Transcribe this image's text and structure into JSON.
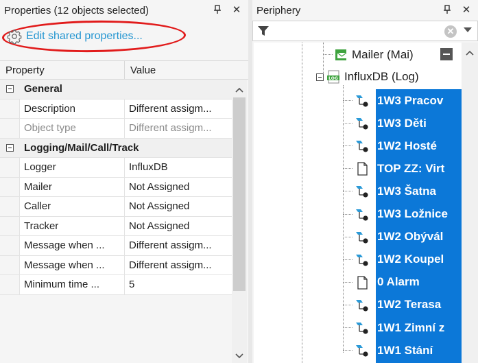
{
  "properties": {
    "title": "Properties (12 objects selected)",
    "pin_icon": "pin-icon",
    "close_glyph": "✕",
    "edit_shared_label": "Edit shared properties...",
    "header": {
      "property": "Property",
      "value": "Value"
    },
    "rows": [
      {
        "type": "category",
        "label": "General"
      },
      {
        "type": "row",
        "name": "Description",
        "value": "Different assigm...",
        "grey": false
      },
      {
        "type": "row",
        "name": "Object type",
        "value": "Different assigm...",
        "grey": true
      },
      {
        "type": "category",
        "label": "Logging/Mail/Call/Track"
      },
      {
        "type": "row",
        "name": "Logger",
        "value": "InfluxDB",
        "grey": false
      },
      {
        "type": "row",
        "name": "Mailer",
        "value": "Not Assigned",
        "grey": false
      },
      {
        "type": "row",
        "name": "Caller",
        "value": "Not Assigned",
        "grey": false
      },
      {
        "type": "row",
        "name": "Tracker",
        "value": "Not Assigned",
        "grey": false
      },
      {
        "type": "row",
        "name": "Message when ...",
        "value": "Different assigm...",
        "grey": false
      },
      {
        "type": "row",
        "name": "Message when ...",
        "value": "Different assigm...",
        "grey": false
      },
      {
        "type": "row",
        "name": "Minimum time ...",
        "value": "5",
        "grey": false
      }
    ]
  },
  "periphery": {
    "title": "Periphery",
    "close_glyph": "✕",
    "filter_value": "",
    "clear_glyph": "✕",
    "mailer_node": "Mailer (Mai)",
    "influx_node": "InfluxDB (Log)",
    "items": [
      {
        "label": "1W3 Pracov",
        "icon": "sensor-icon"
      },
      {
        "label": "1W3 Děti",
        "icon": "sensor-icon"
      },
      {
        "label": "1W2 Hosté",
        "icon": "sensor-icon"
      },
      {
        "label": "TOP ZZ: Virt",
        "icon": "document-icon"
      },
      {
        "label": "1W3 Šatna",
        "icon": "sensor-icon"
      },
      {
        "label": "1W3 Ložnice",
        "icon": "sensor-icon"
      },
      {
        "label": "1W2 Obývál",
        "icon": "sensor-icon"
      },
      {
        "label": "1W2 Koupel",
        "icon": "sensor-icon"
      },
      {
        "label": "0 Alarm",
        "icon": "document-icon"
      },
      {
        "label": "1W2 Terasa",
        "icon": "sensor-icon"
      },
      {
        "label": "1W1 Zimní z",
        "icon": "sensor-icon"
      },
      {
        "label": "1W1 Stání",
        "icon": "sensor-icon"
      }
    ],
    "selection_color": "#0c78d8"
  },
  "colors": {
    "link": "#2596d1",
    "annotation": "#e11b1b"
  }
}
